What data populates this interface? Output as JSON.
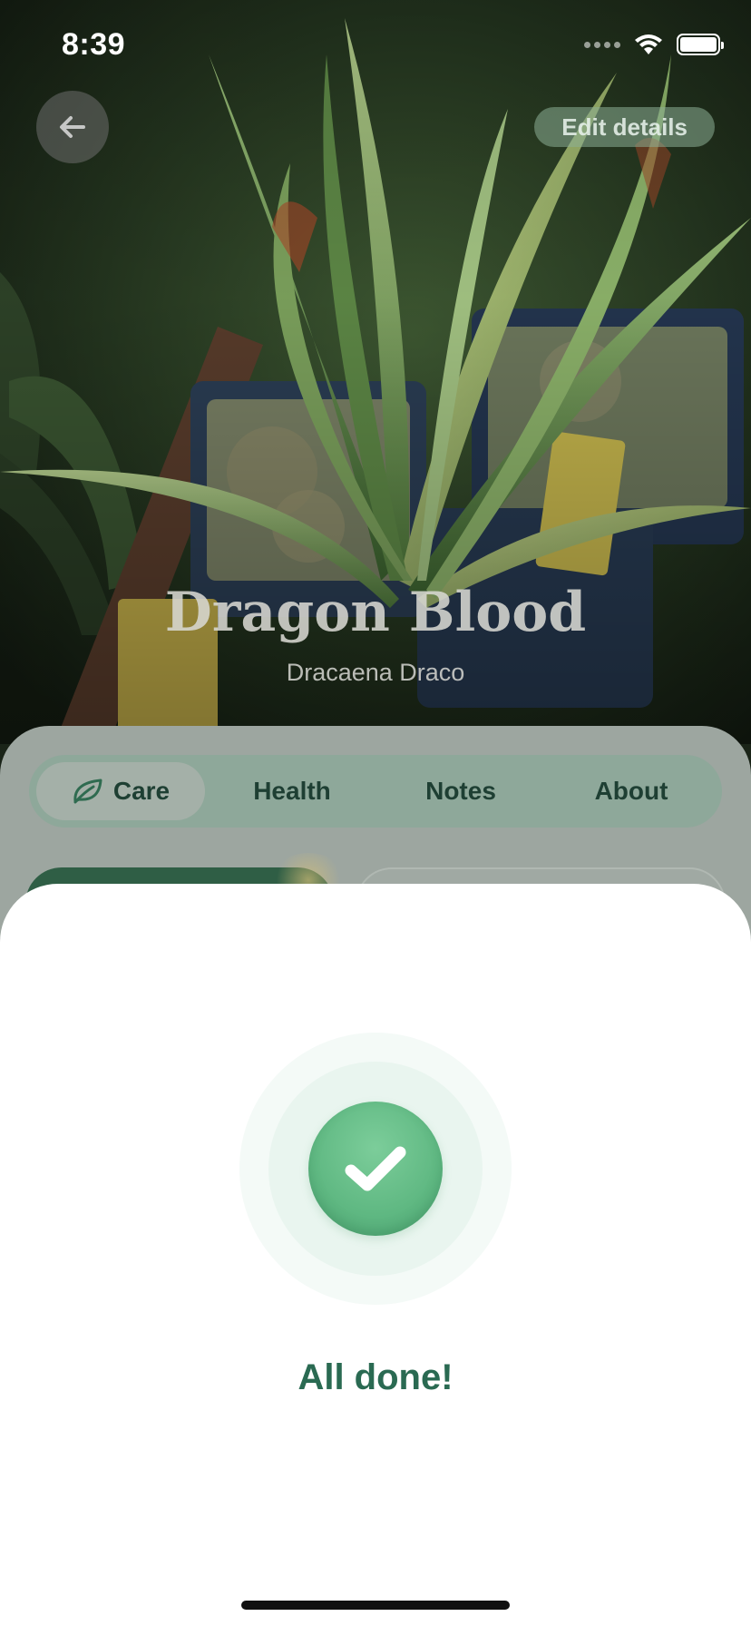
{
  "status_bar": {
    "time": "8:39"
  },
  "header": {
    "back_icon": "arrow-left-icon",
    "edit_label": "Edit details"
  },
  "plant": {
    "name": "Dragon Blood",
    "species": "Dracaena Draco"
  },
  "tabs": [
    {
      "label": "Care",
      "icon": "leaf-icon",
      "active": true
    },
    {
      "label": "Health",
      "active": false
    },
    {
      "label": "Notes",
      "active": false
    },
    {
      "label": "About",
      "active": false
    }
  ],
  "modal": {
    "icon": "checkmark-icon",
    "title": "All done!"
  },
  "colors": {
    "accent_green": "#5fb882",
    "title_green": "#2a6a52",
    "tab_text": "#1e3f33"
  }
}
